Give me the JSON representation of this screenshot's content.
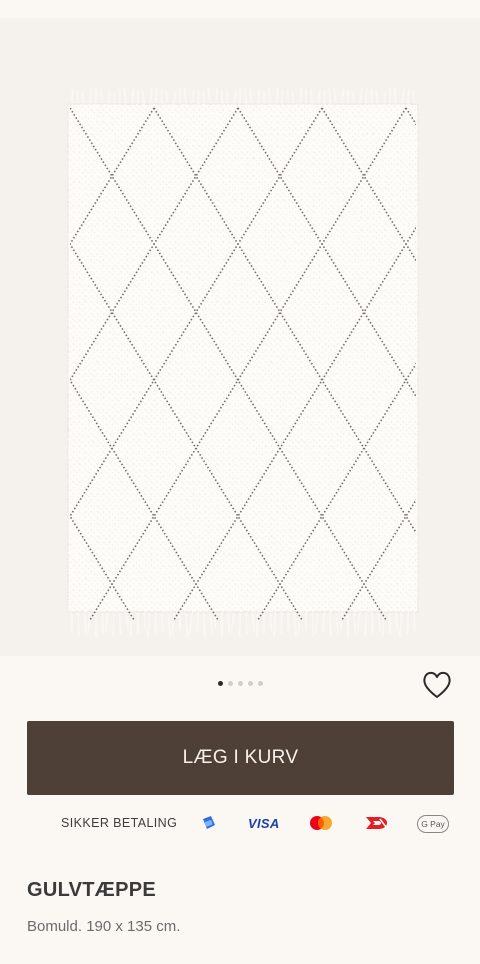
{
  "product": {
    "image_alt": "Hvidt bomuldstæppe med sort rudemønster",
    "carousel": {
      "count": 5,
      "active_index": 0
    },
    "title": "GULVTÆPPE",
    "description": "Bomuld. 190 x 135 cm."
  },
  "actions": {
    "add_to_cart_label": "LÆG I KURV",
    "favorite_icon": "heart-icon"
  },
  "payment": {
    "label": "SIKKER BETALING",
    "methods": [
      {
        "name": "mobilepay",
        "icon": "mobilepay-icon",
        "color": "#2f6ee0"
      },
      {
        "name": "visa",
        "text": "VISA",
        "color": "#1a3fa8"
      },
      {
        "name": "mastercard",
        "icon": "mastercard-icon",
        "colors": [
          "#eb001b",
          "#f79e1b"
        ]
      },
      {
        "name": "dankort",
        "icon": "dankort-icon",
        "color": "#e31e24"
      },
      {
        "name": "google-pay",
        "text": "G Pay"
      }
    ]
  },
  "colors": {
    "button_bg": "#4f4037",
    "button_text": "#f7f2ec",
    "page_bg": "#fbf8f4",
    "image_bg": "#f5f1ec"
  }
}
